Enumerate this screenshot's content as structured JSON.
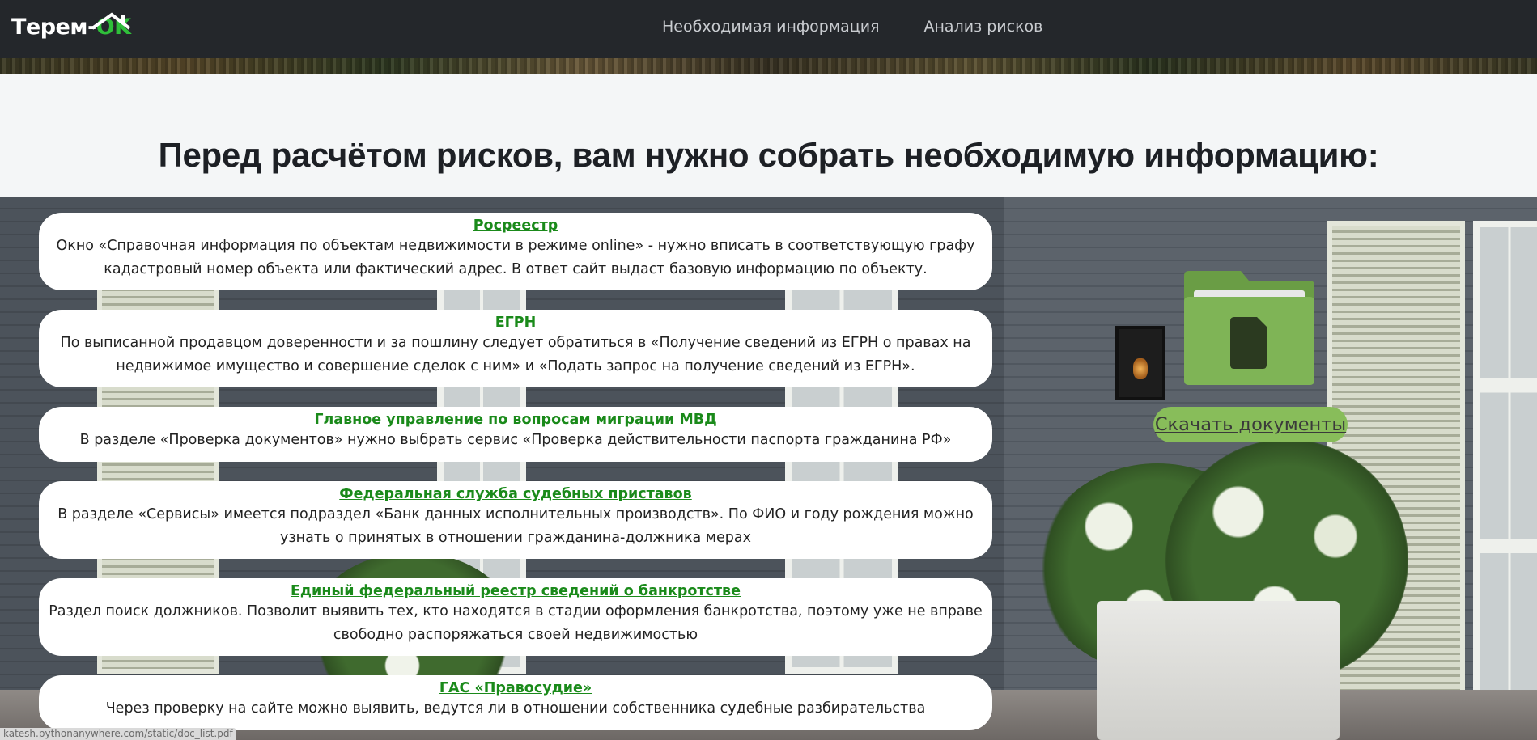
{
  "header": {
    "logo_text_main": "Терем",
    "logo_text_dash": "-",
    "logo_text_accent": "OK",
    "nav": [
      "Необходимая информация",
      "Анализ рисков"
    ]
  },
  "page": {
    "title": "Перед расчётом рисков, вам нужно собрать необходимую информацию:"
  },
  "cards": [
    {
      "title": "Росреестр",
      "text": "Окно «Справочная информация по объектам недвижимости в режиме online» - нужно вписать в соответствующую графу кадастровый номер объекта или фактический адрес. В ответ сайт выдаст базовую информацию по объекту."
    },
    {
      "title": "ЕГРН",
      "text": "По выписанной продавцом доверенности и за пошлину следует обратиться в «Получение сведений из ЕГРН о правах на недвижимое имущество и совершение сделок с ним» и «Подать запрос на получение сведений из ЕГРН»."
    },
    {
      "title": "Главное управление по вопросам миграции МВД",
      "text": "В разделе «Проверка документов» нужно выбрать сервис «Проверка действительности паспорта гражданина РФ»"
    },
    {
      "title": "Федеральная служба судебных приставов",
      "text": "В разделе «Сервисы» имеется подраздел «Банк данных исполнительных производств». По ФИО и году рождения можно узнать о принятых в отношении гражданина-должника мерах"
    },
    {
      "title": "Единый федеральный реестр сведений о банкротстве",
      "text": "Раздел поиск должников. Позволит выявить тех, кто находятся в стадии оформления банкротства, поэтому уже не вправе свободно распоряжаться своей недвижимостью"
    },
    {
      "title": "ГАС «Правосудие»",
      "text": "Через проверку на сайте можно выявить, ведутся ли в отношении собственника судебные разбирательства"
    }
  ],
  "download": {
    "label": "Скачать документы",
    "icon": "folder-document-icon"
  },
  "status_bar": {
    "url": "katesh.pythonanywhere.com/static/doc_list.pdf"
  },
  "colors": {
    "header_bg": "#24272b",
    "accent_green": "#1a8a1a",
    "logo_ok": "#2fbf3a",
    "folder_green": "#7aad52",
    "button_green": "#88bd5a"
  }
}
